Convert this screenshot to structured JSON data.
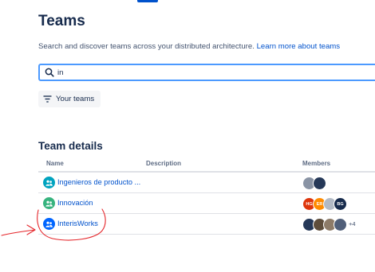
{
  "header": {
    "title": "Teams",
    "intro_text": "Search and discover teams across your distributed architecture.",
    "learn_more_link": "Learn more about teams"
  },
  "search": {
    "value": "in",
    "icon": "search-icon"
  },
  "filter": {
    "your_teams_label": "Your teams",
    "icon": "filter-icon"
  },
  "team_details": {
    "title": "Team details",
    "columns": {
      "name": "Name",
      "description": "Description",
      "members": "Members"
    },
    "rows": [
      {
        "name": "Ingenieros de producto ...",
        "description": "",
        "icon_color": "#00a3bf",
        "members": [
          {
            "initials": "",
            "color": "#8993a4"
          },
          {
            "initials": "",
            "color": "#253858"
          }
        ],
        "more": ""
      },
      {
        "name": "Innovación",
        "description": "",
        "icon_color": "#36b37e",
        "members": [
          {
            "initials": "HG",
            "color": "#de350b"
          },
          {
            "initials": "ER",
            "color": "#ff8b00"
          },
          {
            "initials": "",
            "color": "#b3bac5"
          },
          {
            "initials": "BG",
            "color": "#172b4d"
          }
        ],
        "more": ""
      },
      {
        "name": "InterisWorks",
        "description": "",
        "icon_color": "#0065ff",
        "members": [
          {
            "initials": "",
            "color": "#253858"
          },
          {
            "initials": "",
            "color": "#5e4d3b"
          },
          {
            "initials": "",
            "color": "#8d7b68"
          },
          {
            "initials": "",
            "color": "#505f79"
          }
        ],
        "more": "+4"
      }
    ]
  },
  "colors": {
    "accent": "#0052cc",
    "focus_border": "#4c9aff",
    "annotation": "#e5262b"
  }
}
